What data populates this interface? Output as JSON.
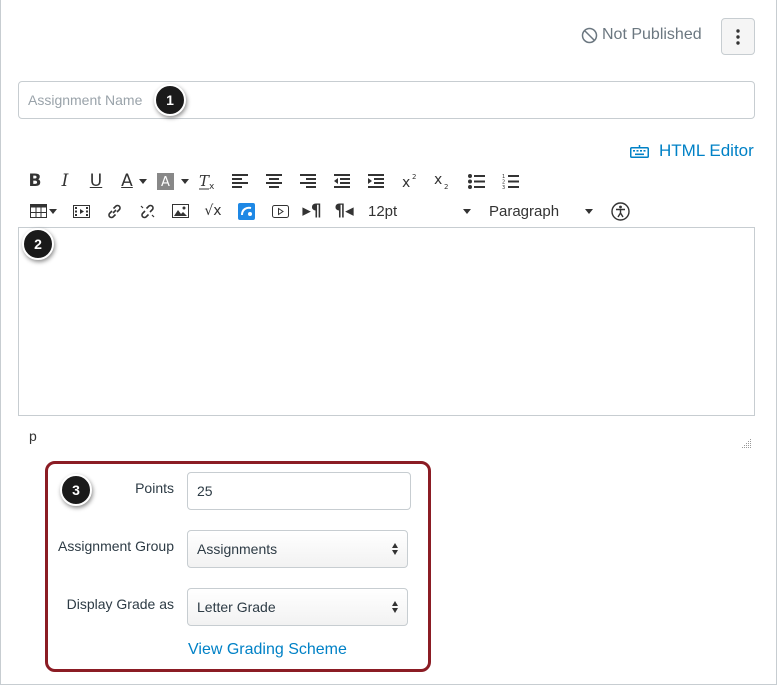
{
  "header": {
    "publish_status": "Not Published"
  },
  "assignment_name": {
    "placeholder": "Assignment Name",
    "value": ""
  },
  "badges": [
    "1",
    "2",
    "3"
  ],
  "editor": {
    "html_editor_label": "HTML Editor",
    "font_size": "12pt",
    "block_format": "Paragraph",
    "path": "p",
    "toolbar_row1": [
      "bold-icon",
      "italic-icon",
      "underline-icon",
      "text-color-icon",
      "background-color-icon",
      "clear-formatting-icon",
      "align-left-icon",
      "align-center-icon",
      "align-right-icon",
      "outdent-icon",
      "indent-icon",
      "superscript-icon",
      "subscript-icon",
      "bullet-list-icon",
      "numbered-list-icon"
    ],
    "toolbar_row2": [
      "table-icon",
      "media-icon",
      "link-icon",
      "unlink-icon",
      "image-icon",
      "math-equation-icon",
      "apps-icon",
      "embed-icon",
      "ltr-paragraph-icon",
      "rtl-paragraph-icon",
      "accessibility-icon"
    ]
  },
  "options": {
    "points_label": "Points",
    "points_value": "25",
    "assignment_group_label": "Assignment Group",
    "assignment_group_value": "Assignments",
    "display_grade_label": "Display Grade as",
    "display_grade_value": "Letter Grade",
    "grading_scheme_link": "View Grading Scheme"
  },
  "colors": {
    "link": "#0081c6",
    "highlight_border": "#8b1c24",
    "badge": "#1a1a1a"
  }
}
